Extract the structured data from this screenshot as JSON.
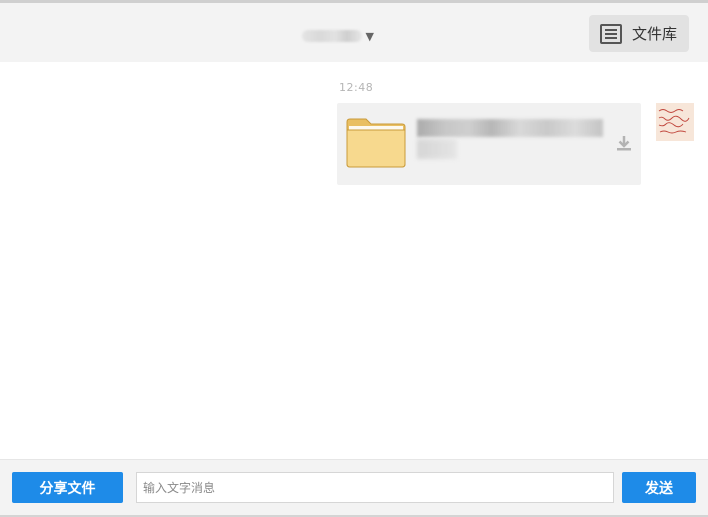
{
  "header": {
    "conversation_title_icon": "chevron-down-icon",
    "library_button": {
      "label": "文件库",
      "icon": "file-library-icon"
    }
  },
  "chat": {
    "messages": [
      {
        "time": "12:48",
        "type": "file",
        "file_icon": "folder-icon",
        "action_icon": "download-icon",
        "sender_avatar": "avatar"
      }
    ]
  },
  "footer": {
    "share_label": "分享文件",
    "input_placeholder": "输入文字消息",
    "input_value": "",
    "send_label": "发送"
  },
  "colors": {
    "accent": "#1e8be8",
    "header_bg": "#f3f3f3",
    "bubble_bg": "#f1f1f1",
    "folder": "#f6d48a"
  }
}
